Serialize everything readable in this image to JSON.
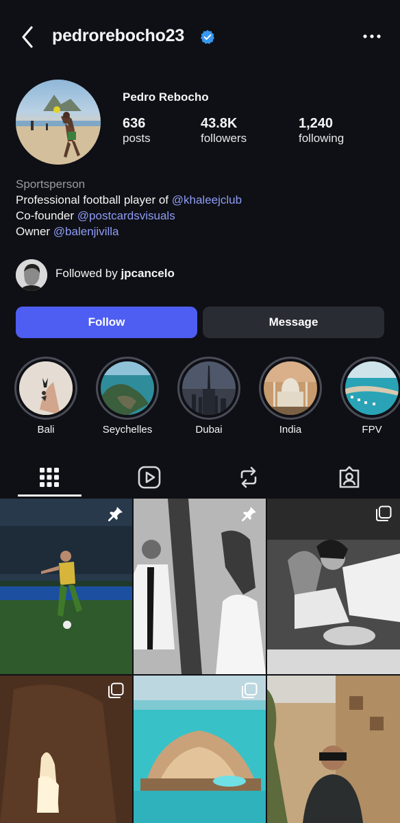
{
  "header": {
    "username": "pedrorebocho23"
  },
  "profile": {
    "name": "Pedro Rebocho",
    "stats": [
      {
        "value": "636",
        "label": "posts"
      },
      {
        "value": "43.8K",
        "label": "followers"
      },
      {
        "value": "1,240",
        "label": "following"
      }
    ]
  },
  "bio": {
    "category": "Sportsperson",
    "lines": [
      {
        "text": "Professional football player of ",
        "link": "@khaleejclub"
      },
      {
        "text": "Co-founder ",
        "link": "@postcardsvisuals"
      },
      {
        "text": "Owner ",
        "link": "@balenjivilla"
      }
    ]
  },
  "followed_by": {
    "prefix": "Followed by ",
    "user": "jpcancelo"
  },
  "buttons": {
    "follow": "Follow",
    "message": "Message"
  },
  "highlights": [
    {
      "label": "Bali"
    },
    {
      "label": "Seychelles"
    },
    {
      "label": "Dubai"
    },
    {
      "label": "India"
    },
    {
      "label": "FPV"
    }
  ],
  "tabs": [
    {
      "icon": "grid-icon",
      "active": true
    },
    {
      "icon": "reels-icon",
      "active": false
    },
    {
      "icon": "reposts-icon",
      "active": false
    },
    {
      "icon": "tagged-icon",
      "active": false
    }
  ],
  "posts": [
    {
      "badge": "pin-icon"
    },
    {
      "badge": "pin-icon"
    },
    {
      "badge": "carousel-icon"
    },
    {
      "badge": "carousel-icon"
    },
    {
      "badge": "carousel-icon"
    },
    {
      "badge": ""
    }
  ],
  "colors": {
    "accent": "#4e5ef2",
    "link": "#8e9cf7",
    "background": "#0f1015",
    "verified": "#3897f0"
  }
}
